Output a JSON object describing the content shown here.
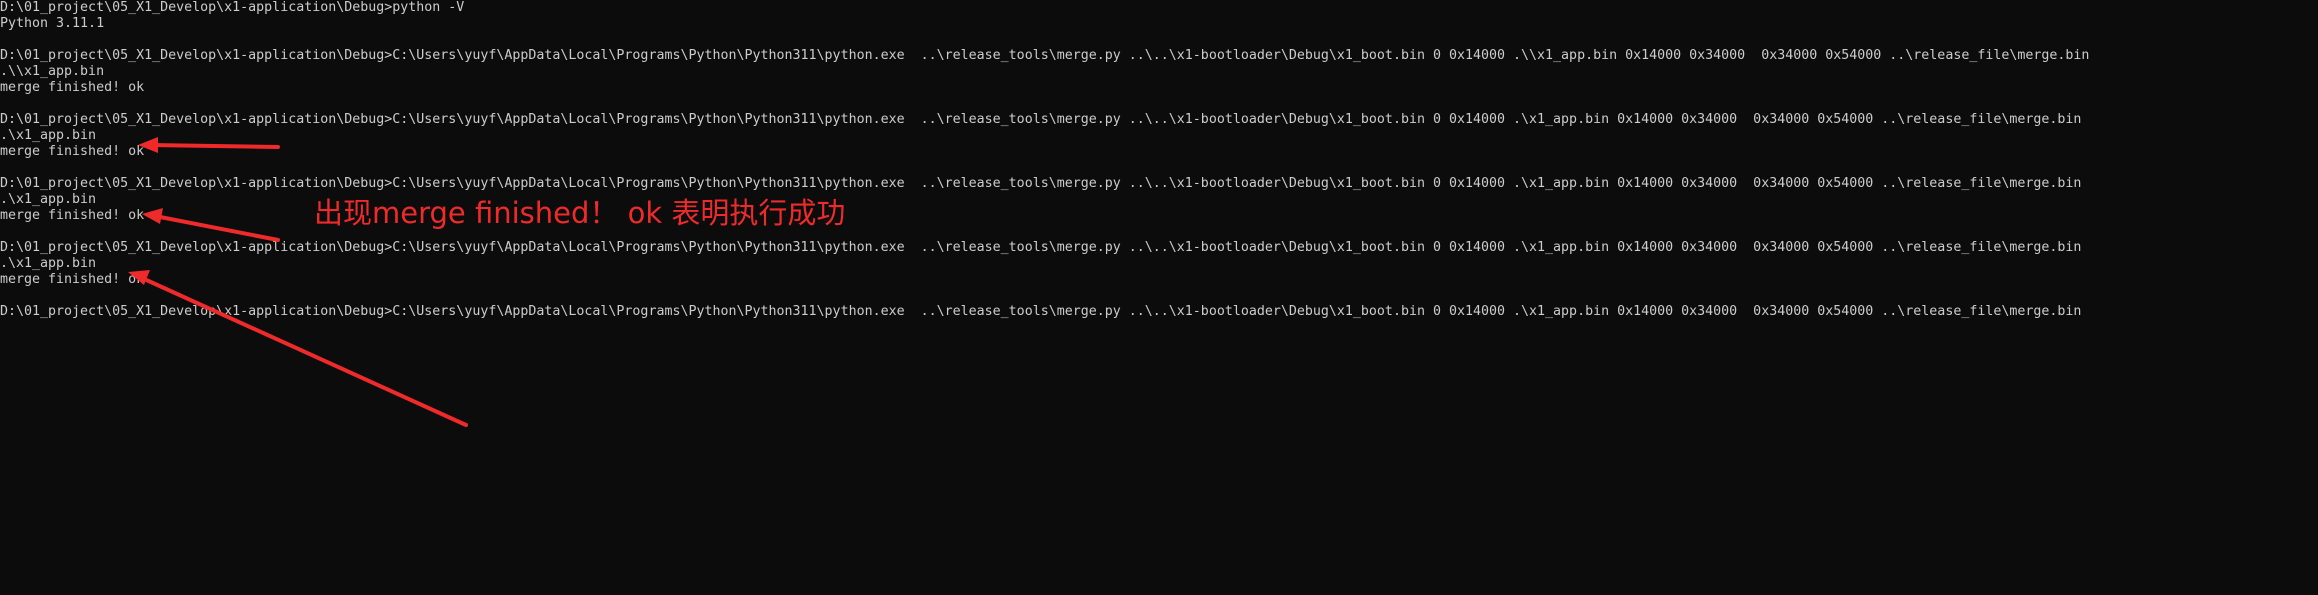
{
  "terminal": {
    "lines": [
      "D:\\01_project\\05_X1_Develop\\x1-application\\Debug>python -V",
      "Python 3.11.1",
      "",
      "D:\\01_project\\05_X1_Develop\\x1-application\\Debug>C:\\Users\\yuyf\\AppData\\Local\\Programs\\Python\\Python311\\python.exe  ..\\release_tools\\merge.py ..\\..\\x1-bootloader\\Debug\\x1_boot.bin 0 0x14000 .\\\\x1_app.bin 0x14000 0x34000  0x34000 0x54000 ..\\release_file\\merge.bin",
      ".\\\\x1_app.bin",
      "merge finished! ok",
      "",
      "D:\\01_project\\05_X1_Develop\\x1-application\\Debug>C:\\Users\\yuyf\\AppData\\Local\\Programs\\Python\\Python311\\python.exe  ..\\release_tools\\merge.py ..\\..\\x1-bootloader\\Debug\\x1_boot.bin 0 0x14000 .\\x1_app.bin 0x14000 0x34000  0x34000 0x54000 ..\\release_file\\merge.bin",
      ".\\x1_app.bin",
      "merge finished! ok",
      "",
      "D:\\01_project\\05_X1_Develop\\x1-application\\Debug>C:\\Users\\yuyf\\AppData\\Local\\Programs\\Python\\Python311\\python.exe  ..\\release_tools\\merge.py ..\\..\\x1-bootloader\\Debug\\x1_boot.bin 0 0x14000 .\\x1_app.bin 0x14000 0x34000  0x34000 0x54000 ..\\release_file\\merge.bin",
      ".\\x1_app.bin",
      "merge finished! ok",
      "",
      "D:\\01_project\\05_X1_Develop\\x1-application\\Debug>C:\\Users\\yuyf\\AppData\\Local\\Programs\\Python\\Python311\\python.exe  ..\\release_tools\\merge.py ..\\..\\x1-bootloader\\Debug\\x1_boot.bin 0 0x14000 .\\x1_app.bin 0x14000 0x34000  0x34000 0x54000 ..\\release_file\\merge.bin",
      ".\\x1_app.bin",
      "merge finished! ok",
      "",
      "D:\\01_project\\05_X1_Develop\\x1-application\\Debug>C:\\Users\\yuyf\\AppData\\Local\\Programs\\Python\\Python311\\python.exe  ..\\release_tools\\merge.py ..\\..\\x1-bootloader\\Debug\\x1_boot.bin 0 0x14000 .\\x1_app.bin 0x14000 0x34000  0x34000 0x54000 ..\\release_file\\merge.bin"
    ]
  },
  "annotation": {
    "text": "出现merge finished！ ok 表明执行成功",
    "color": "#ee2a2a"
  },
  "theme": {
    "background": "#0c0c0c",
    "text_color": "#cccccc"
  }
}
